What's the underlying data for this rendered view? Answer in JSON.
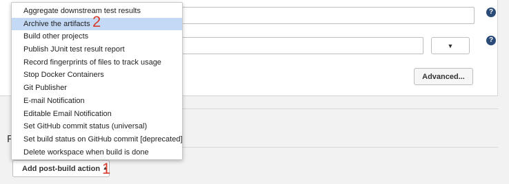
{
  "config": {
    "advanced_label": "Advanced...",
    "help_glyph": "?",
    "dropdown_glyph": "▼"
  },
  "section": {
    "heading_fragment": "P"
  },
  "post_build": {
    "add_button_label": "Add post-build action",
    "caret_glyph": "▲"
  },
  "menu": {
    "items": [
      {
        "label": "Aggregate downstream test results"
      },
      {
        "label": "Archive the artifacts"
      },
      {
        "label": "Build other projects"
      },
      {
        "label": "Publish JUnit test result report"
      },
      {
        "label": "Record fingerprints of files to track usage"
      },
      {
        "label": "Stop Docker Containers"
      },
      {
        "label": "Git Publisher"
      },
      {
        "label": "E-mail Notification"
      },
      {
        "label": "Editable Email Notification"
      },
      {
        "label": "Set GitHub commit status (universal)"
      },
      {
        "label": "Set build status on GitHub commit [deprecated]"
      },
      {
        "label": "Delete workspace when build is done"
      }
    ],
    "highlighted_index": 1,
    "highlight_color": "#c3d9f5"
  },
  "annotations": {
    "first": "1",
    "second": "2",
    "color": "#d83b2d"
  }
}
